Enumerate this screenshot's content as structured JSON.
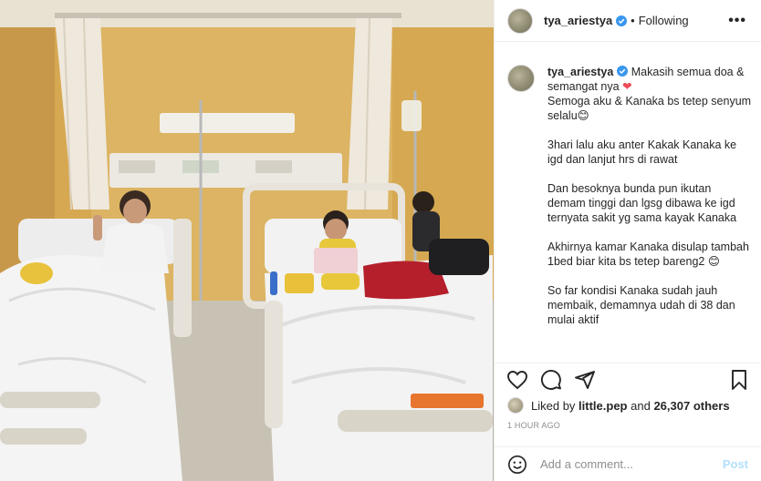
{
  "header": {
    "username": "tya_ariestya",
    "separator": "•",
    "follow_status": "Following",
    "more_label": "•••"
  },
  "caption": {
    "username": "tya_ariestya",
    "line1": "Makasih semua doa &",
    "line2": "semangat nya",
    "heart": "❤",
    "line3": "Semoga aku & Kanaka bs tetep senyum selalu",
    "smile1": "😊",
    "para2": "3hari lalu aku anter Kakak Kanaka ke igd dan lanjut hrs di rawat",
    "para3": "Dan besoknya bunda pun ikutan demam tinggi dan lgsg dibawa ke igd ternyata sakit yg sama kayak Kanaka",
    "para4": "Akhirnya kamar Kanaka disulap tambah 1bed biar kita bs tetep bareng2",
    "smile2": "😊",
    "para5": "So far kondisi Kanaka sudah jauh membaik, demamnya udah di 38 dan mulai aktif"
  },
  "likes": {
    "prefix": "Liked by",
    "user": "little.pep",
    "and": "and",
    "count": "26,307 others"
  },
  "time_ago": "1 HOUR AGO",
  "comment": {
    "placeholder": "Add a comment...",
    "post_label": "Post"
  },
  "icons": {
    "like": "heart-icon",
    "comment": "comment-icon",
    "share": "share-icon",
    "save": "bookmark-icon",
    "emoji": "emoji-icon",
    "verified": "verified-badge-icon"
  },
  "colors": {
    "verified": "#3897f0",
    "post_disabled": "#b2dffc",
    "heart": "#ed4956"
  }
}
